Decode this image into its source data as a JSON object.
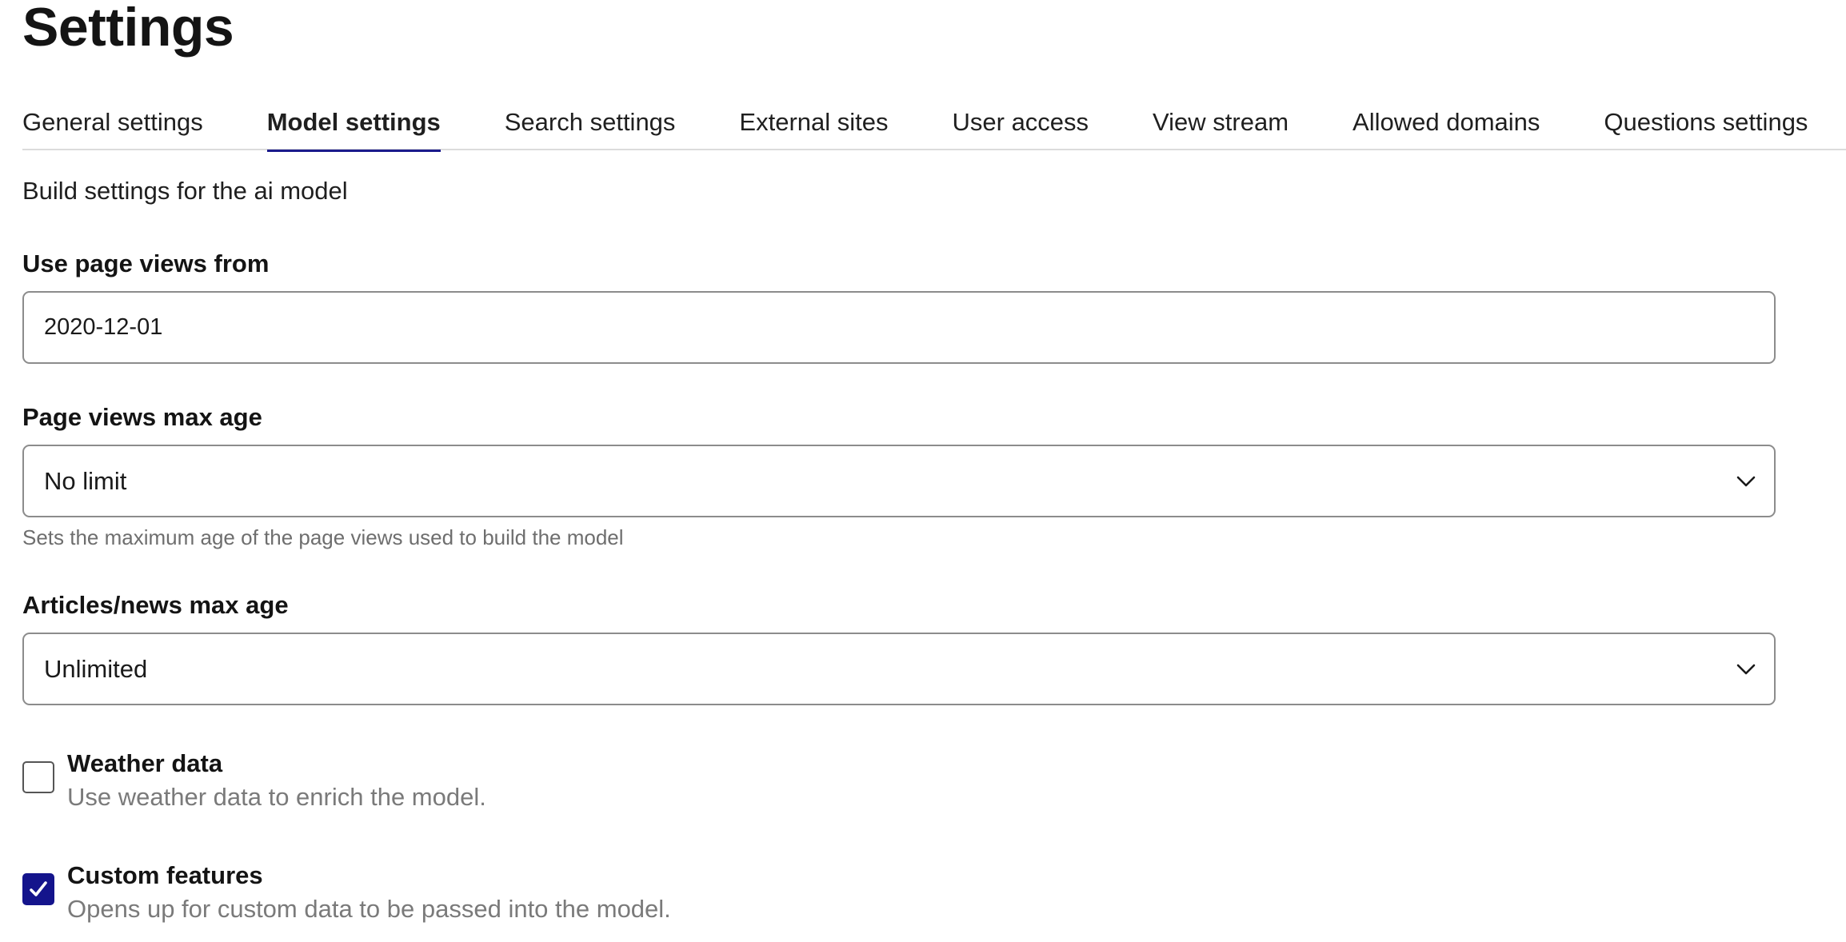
{
  "page": {
    "title": "Settings"
  },
  "tabs": [
    {
      "label": "General settings",
      "active": false
    },
    {
      "label": "Model settings",
      "active": true
    },
    {
      "label": "Search settings",
      "active": false
    },
    {
      "label": "External sites",
      "active": false
    },
    {
      "label": "User access",
      "active": false
    },
    {
      "label": "View stream",
      "active": false
    },
    {
      "label": "Allowed domains",
      "active": false
    },
    {
      "label": "Questions settings",
      "active": false
    }
  ],
  "intro": "Build settings for the ai model",
  "fields": {
    "page_views_from": {
      "label": "Use page views from",
      "value": "2020-12-01"
    },
    "page_views_max_age": {
      "label": "Page views max age",
      "selected": "No limit",
      "helper": "Sets the maximum age of the page views used to build the model"
    },
    "articles_max_age": {
      "label": "Articles/news max age",
      "selected": "Unlimited"
    }
  },
  "checkboxes": {
    "weather": {
      "title": "Weather data",
      "description": "Use weather data to enrich the model.",
      "checked": false
    },
    "custom": {
      "title": "Custom features",
      "description": "Opens up for custom data to be passed into the model.",
      "checked": true
    }
  },
  "colors": {
    "accent": "#14148c",
    "border": "#8c8c8c",
    "muted_text": "#7a7a7a"
  }
}
